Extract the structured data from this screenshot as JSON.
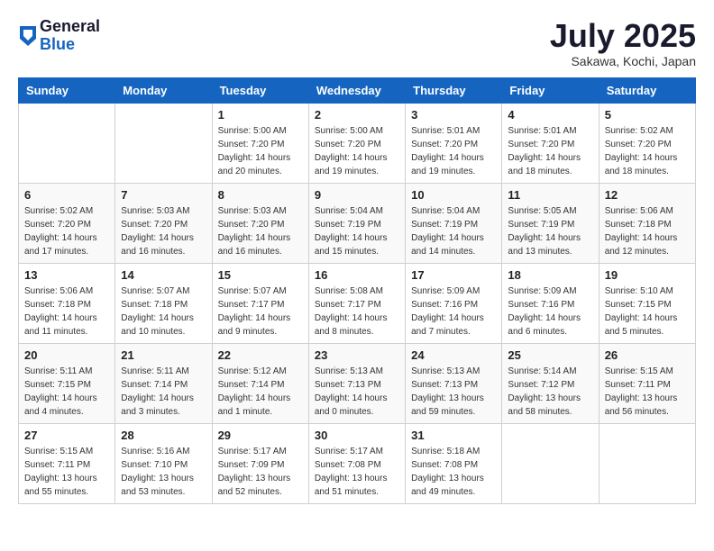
{
  "logo": {
    "general": "General",
    "blue": "Blue"
  },
  "title": {
    "month": "July 2025",
    "location": "Sakawa, Kochi, Japan"
  },
  "weekdays": [
    "Sunday",
    "Monday",
    "Tuesday",
    "Wednesday",
    "Thursday",
    "Friday",
    "Saturday"
  ],
  "weeks": [
    [
      {
        "day": null,
        "info": null
      },
      {
        "day": null,
        "info": null
      },
      {
        "day": "1",
        "info": "Sunrise: 5:00 AM\nSunset: 7:20 PM\nDaylight: 14 hours\nand 20 minutes."
      },
      {
        "day": "2",
        "info": "Sunrise: 5:00 AM\nSunset: 7:20 PM\nDaylight: 14 hours\nand 19 minutes."
      },
      {
        "day": "3",
        "info": "Sunrise: 5:01 AM\nSunset: 7:20 PM\nDaylight: 14 hours\nand 19 minutes."
      },
      {
        "day": "4",
        "info": "Sunrise: 5:01 AM\nSunset: 7:20 PM\nDaylight: 14 hours\nand 18 minutes."
      },
      {
        "day": "5",
        "info": "Sunrise: 5:02 AM\nSunset: 7:20 PM\nDaylight: 14 hours\nand 18 minutes."
      }
    ],
    [
      {
        "day": "6",
        "info": "Sunrise: 5:02 AM\nSunset: 7:20 PM\nDaylight: 14 hours\nand 17 minutes."
      },
      {
        "day": "7",
        "info": "Sunrise: 5:03 AM\nSunset: 7:20 PM\nDaylight: 14 hours\nand 16 minutes."
      },
      {
        "day": "8",
        "info": "Sunrise: 5:03 AM\nSunset: 7:20 PM\nDaylight: 14 hours\nand 16 minutes."
      },
      {
        "day": "9",
        "info": "Sunrise: 5:04 AM\nSunset: 7:19 PM\nDaylight: 14 hours\nand 15 minutes."
      },
      {
        "day": "10",
        "info": "Sunrise: 5:04 AM\nSunset: 7:19 PM\nDaylight: 14 hours\nand 14 minutes."
      },
      {
        "day": "11",
        "info": "Sunrise: 5:05 AM\nSunset: 7:19 PM\nDaylight: 14 hours\nand 13 minutes."
      },
      {
        "day": "12",
        "info": "Sunrise: 5:06 AM\nSunset: 7:18 PM\nDaylight: 14 hours\nand 12 minutes."
      }
    ],
    [
      {
        "day": "13",
        "info": "Sunrise: 5:06 AM\nSunset: 7:18 PM\nDaylight: 14 hours\nand 11 minutes."
      },
      {
        "day": "14",
        "info": "Sunrise: 5:07 AM\nSunset: 7:18 PM\nDaylight: 14 hours\nand 10 minutes."
      },
      {
        "day": "15",
        "info": "Sunrise: 5:07 AM\nSunset: 7:17 PM\nDaylight: 14 hours\nand 9 minutes."
      },
      {
        "day": "16",
        "info": "Sunrise: 5:08 AM\nSunset: 7:17 PM\nDaylight: 14 hours\nand 8 minutes."
      },
      {
        "day": "17",
        "info": "Sunrise: 5:09 AM\nSunset: 7:16 PM\nDaylight: 14 hours\nand 7 minutes."
      },
      {
        "day": "18",
        "info": "Sunrise: 5:09 AM\nSunset: 7:16 PM\nDaylight: 14 hours\nand 6 minutes."
      },
      {
        "day": "19",
        "info": "Sunrise: 5:10 AM\nSunset: 7:15 PM\nDaylight: 14 hours\nand 5 minutes."
      }
    ],
    [
      {
        "day": "20",
        "info": "Sunrise: 5:11 AM\nSunset: 7:15 PM\nDaylight: 14 hours\nand 4 minutes."
      },
      {
        "day": "21",
        "info": "Sunrise: 5:11 AM\nSunset: 7:14 PM\nDaylight: 14 hours\nand 3 minutes."
      },
      {
        "day": "22",
        "info": "Sunrise: 5:12 AM\nSunset: 7:14 PM\nDaylight: 14 hours\nand 1 minute."
      },
      {
        "day": "23",
        "info": "Sunrise: 5:13 AM\nSunset: 7:13 PM\nDaylight: 14 hours\nand 0 minutes."
      },
      {
        "day": "24",
        "info": "Sunrise: 5:13 AM\nSunset: 7:13 PM\nDaylight: 13 hours\nand 59 minutes."
      },
      {
        "day": "25",
        "info": "Sunrise: 5:14 AM\nSunset: 7:12 PM\nDaylight: 13 hours\nand 58 minutes."
      },
      {
        "day": "26",
        "info": "Sunrise: 5:15 AM\nSunset: 7:11 PM\nDaylight: 13 hours\nand 56 minutes."
      }
    ],
    [
      {
        "day": "27",
        "info": "Sunrise: 5:15 AM\nSunset: 7:11 PM\nDaylight: 13 hours\nand 55 minutes."
      },
      {
        "day": "28",
        "info": "Sunrise: 5:16 AM\nSunset: 7:10 PM\nDaylight: 13 hours\nand 53 minutes."
      },
      {
        "day": "29",
        "info": "Sunrise: 5:17 AM\nSunset: 7:09 PM\nDaylight: 13 hours\nand 52 minutes."
      },
      {
        "day": "30",
        "info": "Sunrise: 5:17 AM\nSunset: 7:08 PM\nDaylight: 13 hours\nand 51 minutes."
      },
      {
        "day": "31",
        "info": "Sunrise: 5:18 AM\nSunset: 7:08 PM\nDaylight: 13 hours\nand 49 minutes."
      },
      {
        "day": null,
        "info": null
      },
      {
        "day": null,
        "info": null
      }
    ]
  ]
}
